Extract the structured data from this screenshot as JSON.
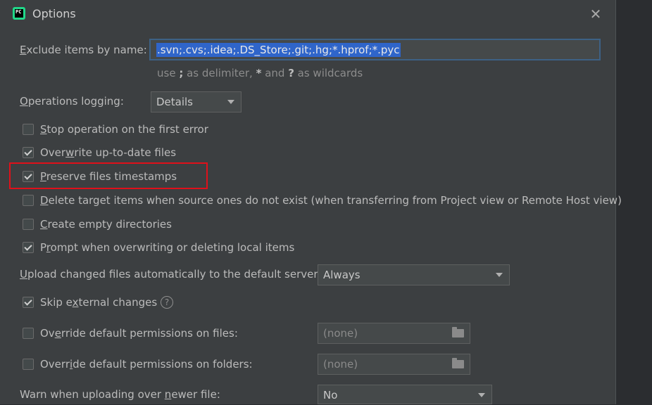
{
  "window": {
    "title": "Options",
    "app_icon": "pycharm-icon",
    "app_icon_text": "PC",
    "close_glyph": "✕"
  },
  "exclude": {
    "label_pre": "",
    "label_mnemonic": "E",
    "label_post": "xclude items by name:",
    "value": ".svn;.cvs;.idea;.DS_Store;.git;.hg;*.hprof;*.pyc",
    "hint_1": "use ",
    "hint_semicolon": ";",
    "hint_2": " as delimiter, ",
    "hint_star": "*",
    "hint_3": " and ",
    "hint_question": "?",
    "hint_4": " as wildcards"
  },
  "logging": {
    "label_pre": "",
    "label_mnemonic": "O",
    "label_post": "perations logging:",
    "selected": "Details"
  },
  "checkboxes": [
    {
      "pre": "",
      "mn": "S",
      "post": "top operation on the first error",
      "checked": false
    },
    {
      "pre": "Over",
      "mn": "w",
      "post": "rite up-to-date files",
      "checked": true
    },
    {
      "pre": "",
      "mn": "P",
      "post": "reserve files timestamps",
      "checked": true
    },
    {
      "pre": "",
      "mn": "D",
      "post": "elete target items when source ones do not exist (when transferring from Project view or Remote Host view)",
      "checked": false
    },
    {
      "pre": "",
      "mn": "C",
      "post": "reate empty directories",
      "checked": false
    },
    {
      "pre": "P",
      "mn": "r",
      "post": "ompt when overwriting or deleting local items",
      "checked": true
    }
  ],
  "upload": {
    "label_pre": "",
    "label_mnemonic": "U",
    "label_post": "pload changed files automatically to the default server",
    "selected": "Always"
  },
  "skip_external": {
    "pre": "Skip e",
    "mn": "x",
    "post": "ternal changes",
    "checked": true,
    "help_glyph": "?"
  },
  "permissions_files": {
    "pre": "Ov",
    "mn": "e",
    "post": "rride default permissions on files:",
    "checked": false,
    "value": "(none)"
  },
  "permissions_folders": {
    "pre": "Overr",
    "mn": "i",
    "post": "de default permissions on folders:",
    "checked": false,
    "value": "(none)"
  },
  "warn_newer": {
    "label_pre": "Warn when uploading over ",
    "label_mnemonic": "n",
    "label_post": "ewer file:",
    "selected": "No"
  },
  "colors": {
    "background": "#3c3f41",
    "field": "#45494a",
    "focus_border": "#3d6185",
    "selection": "#2f65ca",
    "highlight_annotation": "#e0101a"
  }
}
